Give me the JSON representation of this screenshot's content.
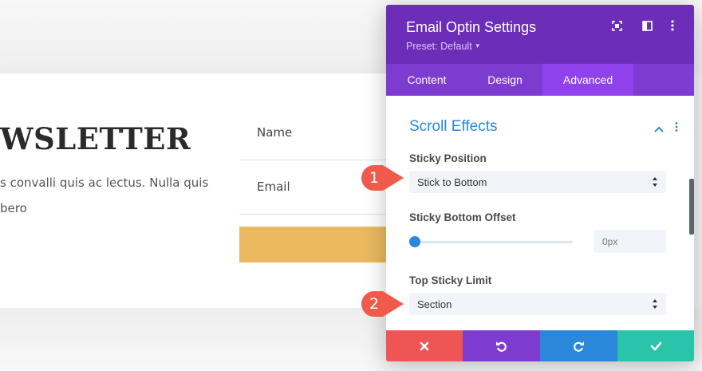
{
  "background": {
    "heading": "WSLETTER",
    "text": "s convalli quis ac lectus. Nulla quis bero",
    "form": {
      "name_label": "Name",
      "email_label": "Email"
    }
  },
  "panel": {
    "title": "Email Optin Settings",
    "preset": "Preset: Default",
    "header_icons": [
      "fullscreen-icon",
      "sidebar-layout-icon",
      "more-vertical-icon"
    ],
    "tabs": [
      {
        "label": "Content",
        "active": false
      },
      {
        "label": "Design",
        "active": false
      },
      {
        "label": "Advanced",
        "active": true
      }
    ],
    "section": {
      "title": "Scroll Effects",
      "sticky_position": {
        "label": "Sticky Position",
        "value": "Stick to Bottom"
      },
      "sticky_bottom_offset": {
        "label": "Sticky Bottom Offset",
        "placeholder": "0px",
        "slider_value": 0
      },
      "top_sticky_limit": {
        "label": "Top Sticky Limit",
        "value": "Section"
      }
    },
    "footer_buttons": [
      "close-icon",
      "undo-icon",
      "redo-icon",
      "check-icon"
    ]
  },
  "callouts": [
    {
      "number": "1"
    },
    {
      "number": "2"
    }
  ],
  "colors": {
    "header_purple": "#6c2eb9",
    "tab_purple": "#7e3bd0",
    "active_tab": "#8f42ec",
    "accent_blue": "#2b87da",
    "cancel_red": "#ef5555",
    "undo_purple": "#7e3bd0",
    "redo_blue": "#2b87da",
    "save_green": "#29c4a9",
    "callout_red": "#ef5a4a",
    "subscribe_yellow": "#ebb95f"
  }
}
